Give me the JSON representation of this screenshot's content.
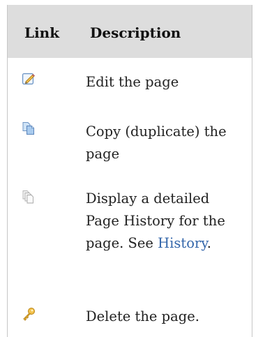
{
  "table": {
    "headers": {
      "link": "Link",
      "description": "Description"
    },
    "rows": [
      {
        "icon": "edit-icon",
        "text": "Edit the page"
      },
      {
        "icon": "copy-icon",
        "text": "Copy (duplicate) the page"
      },
      {
        "icon": "history-icon",
        "text_before": "Display a detailed Page History for the page. See",
        "link_text": "History",
        "text_after": "."
      },
      {
        "icon": "delete-icon",
        "text": "Delete the page."
      }
    ]
  },
  "colors": {
    "header_bg": "#dddddd",
    "link": "#3366aa",
    "border": "#c6c6c6"
  }
}
